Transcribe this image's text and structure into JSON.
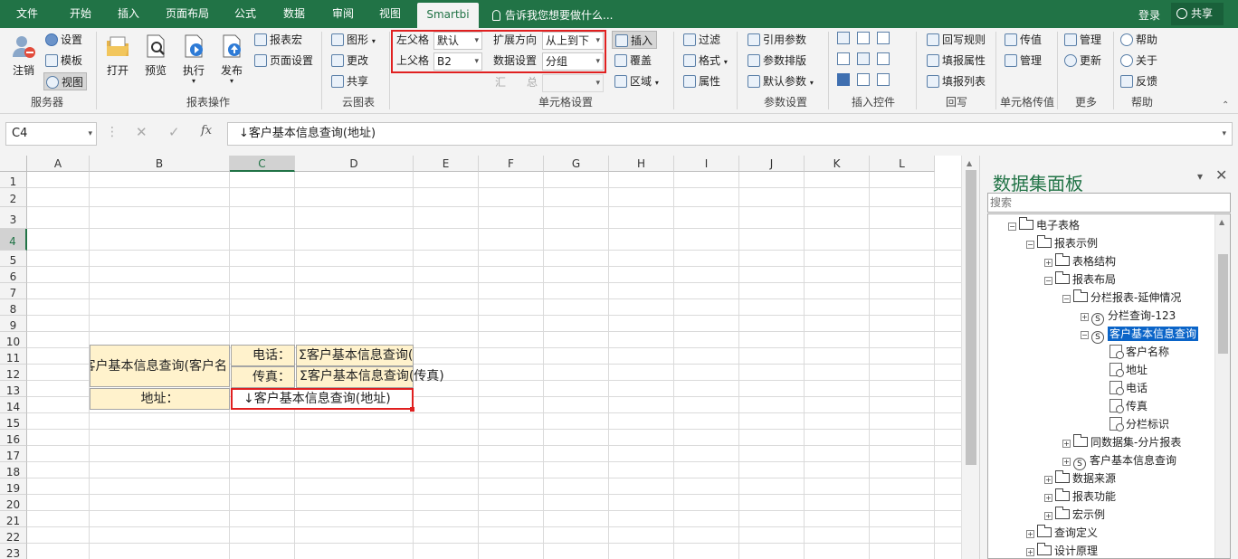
{
  "tabs": [
    "文件",
    "开始",
    "插入",
    "页面布局",
    "公式",
    "数据",
    "审阅",
    "视图",
    "Smartbi"
  ],
  "tell_me": "告诉我您想要做什么...",
  "login": "登录",
  "share": "共享",
  "ribbon": {
    "server": {
      "logout": "注销",
      "settings": "设置",
      "template": "模板",
      "view": "视图",
      "label": "服务器"
    },
    "report_ops": {
      "open": "打开",
      "preview": "预览",
      "execute": "执行",
      "publish": "发布",
      "report_macro": "报表宏",
      "page_setup": "页面设置",
      "label": "报表操作"
    },
    "cloud_chart": {
      "chart": "图形",
      "update": "更改",
      "share": "共享",
      "label": "云图表"
    },
    "cell_settings": {
      "left_parent_label": "左父格",
      "left_parent_value": "默认",
      "expand_dir_label": "扩展方向",
      "expand_dir_value": "从上到下",
      "top_parent_label": "上父格",
      "top_parent_value": "B2",
      "data_setting_label": "数据设置",
      "data_setting_value": "分组",
      "summary_label": "汇",
      "total_label": "总",
      "insert": "插入",
      "cover": "覆盖",
      "region": "区域",
      "filter": "过滤",
      "format": "格式",
      "attribute": "属性",
      "label": "单元格设置"
    },
    "params": {
      "ref": "引用参数",
      "layout": "参数排版",
      "default": "默认参数",
      "label": "参数设置"
    },
    "insert_ctrl": {
      "label": "插入控件"
    },
    "writeback": {
      "rule": "回写规则",
      "attr": "填报属性",
      "list": "填报列表",
      "label": "回写"
    },
    "cell_transfer": {
      "transfer": "传值",
      "manage": "管理",
      "label": "单元格传值"
    },
    "more": {
      "manage": "管理",
      "update": "更新",
      "label": "更多"
    },
    "help": {
      "help": "帮助",
      "about": "关于",
      "feedback": "反馈",
      "label": "帮助"
    }
  },
  "formula_bar": {
    "cell_ref": "C4",
    "fx": "fx",
    "content": "↓客户基本信息查询(地址)"
  },
  "columns": [
    "A",
    "B",
    "C",
    "D",
    "E",
    "F",
    "G",
    "H",
    "I",
    "J",
    "K",
    "L"
  ],
  "rows": [
    "1",
    "2",
    "3",
    "4",
    "5",
    "6",
    "7",
    "8",
    "9",
    "10",
    "11",
    "12",
    "13",
    "14",
    "15",
    "16",
    "17",
    "18",
    "19",
    "20",
    "21",
    "22",
    "23"
  ],
  "cells": {
    "b23": "客户基本信息查询(客户名",
    "c2": "电话：",
    "d2": "Σ客户基本信息查询(电话",
    "c3": "传真：",
    "d3": "Σ客户基本信息查询(传真)",
    "b4": "地址：",
    "c4": "↓客户基本信息查询(地址)"
  },
  "panel": {
    "title": "数据集面板",
    "search_placeholder": "搜索",
    "tree": [
      {
        "label": "电子表格"
      },
      {
        "label": "报表示例"
      },
      {
        "label": "表格结构"
      },
      {
        "label": "报表布局"
      },
      {
        "label": "分栏报表-延伸情况"
      },
      {
        "label": "分栏查询-123"
      },
      {
        "label": "客户基本信息查询"
      },
      {
        "label": "客户名称"
      },
      {
        "label": "地址"
      },
      {
        "label": "电话"
      },
      {
        "label": "传真"
      },
      {
        "label": "分栏标识"
      },
      {
        "label": "同数据集-分片报表"
      },
      {
        "label": "客户基本信息查询"
      },
      {
        "label": "数据来源"
      },
      {
        "label": "报表功能"
      },
      {
        "label": "宏示例"
      },
      {
        "label": "查询定义"
      },
      {
        "label": "设计原理"
      }
    ]
  },
  "colors": {
    "excel_green": "#217346",
    "highlight_red": "#e02020",
    "cell_fill": "#fff2cc",
    "selected_node": "#0a64c8"
  }
}
